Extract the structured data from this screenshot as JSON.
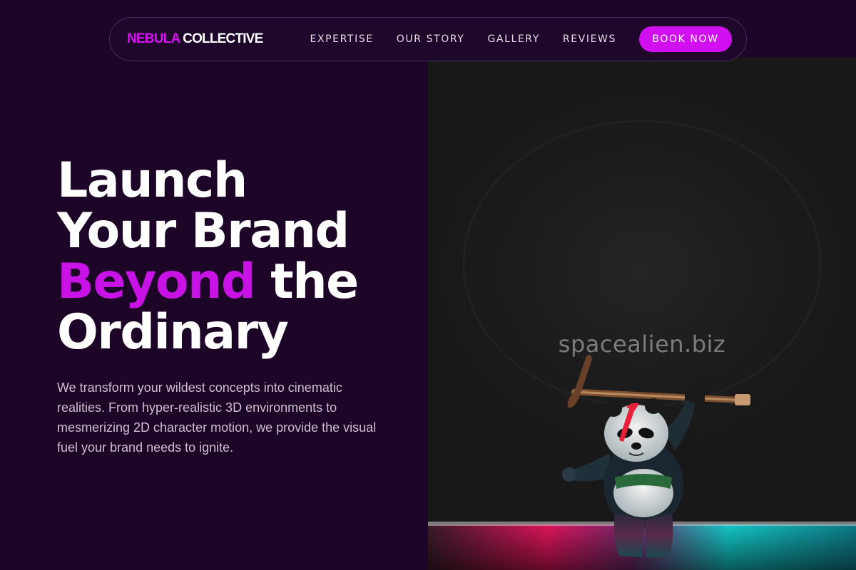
{
  "brand": {
    "name_accent": "NEBULA",
    "name_rest": " COLLECTIVE",
    "accent_color": "#d511ee"
  },
  "nav": {
    "links": [
      {
        "label": "EXPERTISE"
      },
      {
        "label": "OUR STORY"
      },
      {
        "label": "GALLERY"
      },
      {
        "label": "REVIEWS"
      }
    ],
    "cta_label": "BOOK NOW"
  },
  "hero": {
    "headline_line1": "Launch",
    "headline_line2": "Your Brand",
    "headline_highlight": "Beyond",
    "headline_line3_rest": " the",
    "headline_line4": "Ordinary",
    "description": "We transform your wildest concepts into cinematic realities. From hyper-realistic 3D environments to mesmerizing 2D character motion, we provide the visual fuel your brand needs to ignite.",
    "image_watermark": "spacealien.biz",
    "image_subject": "panda-figurine-with-axe"
  },
  "colors": {
    "background": "#1c0527",
    "highlight": "#c812e6",
    "button": "#d10ff0"
  }
}
